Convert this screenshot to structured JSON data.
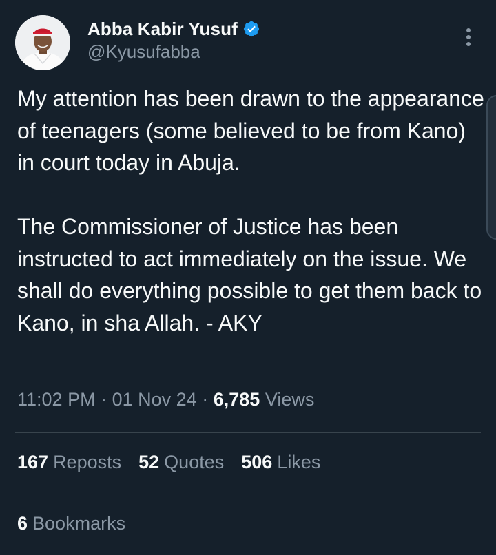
{
  "theme": {
    "background": "#15202b",
    "text_primary": "#f7f9f9",
    "text_secondary": "#8b98a5",
    "divider": "#38444d",
    "verified_badge": "#1d9bf0"
  },
  "author": {
    "avatar_icon": "profile-photo",
    "display_name": "Abba Kabir Yusuf",
    "verified_icon": "verified-badge-icon",
    "handle": "@Kyusufabba"
  },
  "menu": {
    "icon": "more-vertical-icon"
  },
  "tweet": {
    "text": "My attention has been drawn to the appearance of teenagers (some believed to be from Kano) in court today in Abuja.\n\nThe Commissioner of Justice has been instructed to act immediately on the issue. We shall do everything possible to get them back to Kano, in sha Allah. - AKY"
  },
  "meta": {
    "time": "11:02 PM",
    "separator": "·",
    "date": "01 Nov 24",
    "views_count": "6,785",
    "views_label": "Views"
  },
  "stats": {
    "reposts_count": "167",
    "reposts_label": "Reposts",
    "quotes_count": "52",
    "quotes_label": "Quotes",
    "likes_count": "506",
    "likes_label": "Likes"
  },
  "bookmarks": {
    "count": "6",
    "label": "Bookmarks"
  }
}
